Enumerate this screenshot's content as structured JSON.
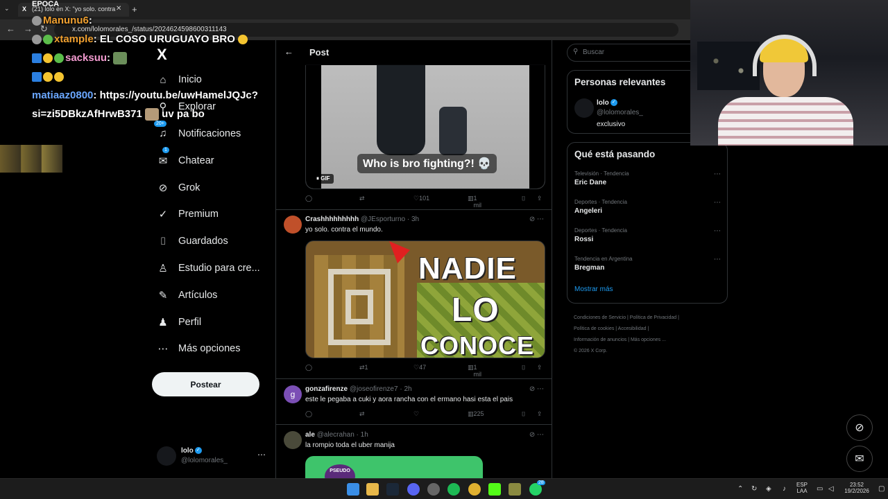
{
  "browser": {
    "tab_title": "(21) lolo en X: \"yo solo. contra",
    "url": "x.com/lolomorales_/status/2024624598600311143"
  },
  "overlay_chat": {
    "top_line": "EPOCA",
    "lines": [
      {
        "user": "Manunu6",
        "sep": ":",
        "text": ""
      },
      {
        "user": "xtample",
        "sep": ":",
        "text": " EL COSO URUGUAYO BRO"
      },
      {
        "user": "sacksuu",
        "sep": ":",
        "text": ""
      },
      {
        "user": "matiaaz0800",
        "sep": ":",
        "text": " https://youtu.be/uwHamelJQJc?"
      },
      {
        "user": "",
        "sep": "",
        "text": "si=zi5DBkzAfHrwB371"
      }
    ],
    "overlap_fragment": "uv pa bo"
  },
  "sidebar": {
    "logo": "X",
    "items": [
      {
        "label": "Inicio",
        "icon": "home-icon",
        "glyph": "⌂"
      },
      {
        "label": "Explorar",
        "icon": "search-icon",
        "glyph": "⚲"
      },
      {
        "label": "Notificaciones",
        "icon": "bell-icon",
        "glyph": "🔔︎",
        "badge": "20+"
      },
      {
        "label": "Chatear",
        "icon": "mail-icon",
        "glyph": "✉",
        "badge": "1"
      },
      {
        "label": "Grok",
        "icon": "grok-icon",
        "glyph": "⊘"
      },
      {
        "label": "Premium",
        "icon": "premium-icon",
        "glyph": "✓"
      },
      {
        "label": "Guardados",
        "icon": "bookmark-icon",
        "glyph": "⌷"
      },
      {
        "label": "Estudio para cre...",
        "icon": "studio-icon",
        "glyph": "♙"
      },
      {
        "label": "Artículos",
        "icon": "article-icon",
        "glyph": "✎"
      },
      {
        "label": "Perfil",
        "icon": "profile-icon",
        "glyph": "♟"
      },
      {
        "label": "Más opciones",
        "icon": "more-icon",
        "glyph": "⋯"
      }
    ],
    "post_button": "Postear",
    "account": {
      "name": "lolo",
      "handle": "@lolomorales_"
    }
  },
  "main": {
    "header_title": "Post",
    "gif_caption": "Who is bro fighting?! 💀",
    "gif_tag": "GIF",
    "post0_stats": {
      "likes": "101",
      "views": "1 mil"
    },
    "replies": [
      {
        "name": "Crashhhhhhhhh",
        "handle": "@JEsporturno",
        "time": "3h",
        "text": "yo solo. contra el mundo.",
        "retweets": "1",
        "likes": "47",
        "views": "1 mil",
        "avatar_color": "#c0502a"
      },
      {
        "name": "gonzafirenze",
        "handle": "@joseofirenze7",
        "time": "2h",
        "text": "este le pegaba a cuki y aora rancha con el ermano hasi esta el pais",
        "retweets": "",
        "likes": "",
        "views": "225",
        "avatar_color": "#7b4fb5",
        "avatar_letter": "g"
      },
      {
        "name": "ale",
        "handle": "@alecrahan",
        "time": "1h",
        "text": "la rompio toda el uber manija",
        "avatar_color": "#4a4a3a"
      }
    ],
    "media_words": [
      "NADIE",
      "LO",
      "CONOCE"
    ],
    "media3_text": "PSEUDO"
  },
  "right": {
    "search_placeholder": "Buscar",
    "relevant_title": "Personas relevantes",
    "relevant_person": {
      "name": "lolo",
      "handle": "@lolomorales_",
      "bio": "exclusivo"
    },
    "trending_title": "Qué está pasando",
    "trends": [
      {
        "category": "Televisión · Tendencia",
        "name": "Eric Dane"
      },
      {
        "category": "Deportes · Tendencia",
        "name": "Angeleri"
      },
      {
        "category": "Deportes · Tendencia",
        "name": "Rossi"
      },
      {
        "category": "Tendencia en Argentina",
        "name": "Bregman"
      }
    ],
    "show_more": "Mostrar más",
    "footer_line1": "Condiciones de Servicio  |  Política de Privacidad  |",
    "footer_line2": "Política de cookies  |  Accesibilidad  |",
    "footer_line3": "Información de anuncios  |  Más opciones ...",
    "footer_line4": "© 2026 X Corp."
  },
  "taskbar": {
    "lang_top": "ESP",
    "lang_bottom": "LAA",
    "time": "23:52",
    "date": "19/2/2026",
    "whatsapp_badge": "28"
  }
}
